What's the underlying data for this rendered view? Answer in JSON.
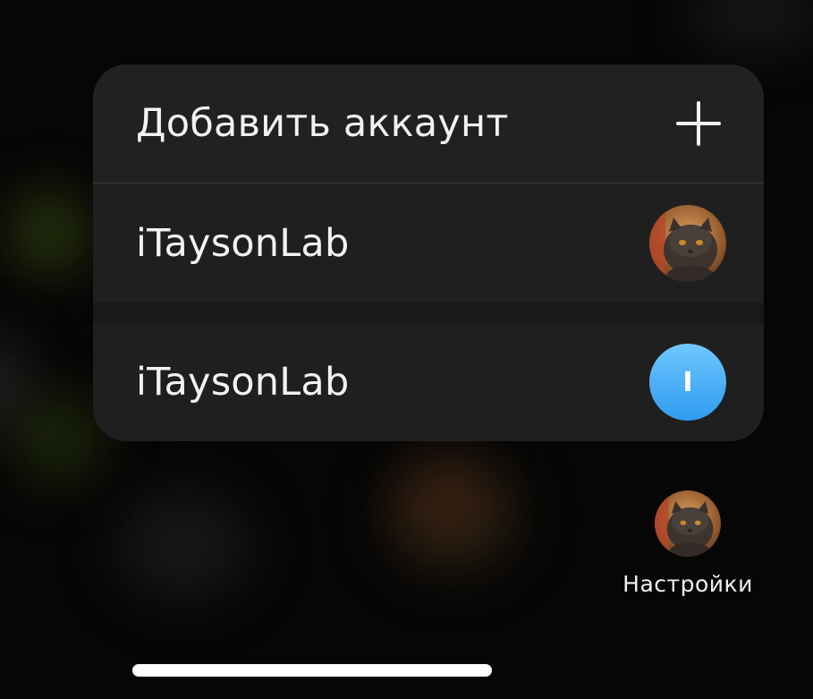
{
  "menu": {
    "add_account_label": "Добавить аккаунт",
    "add_icon": "plus-icon",
    "accounts": [
      {
        "name": "iTaysonLab",
        "avatar": "cat-photo"
      },
      {
        "name": "iTaysonLab",
        "avatar": "initial",
        "initial": "I",
        "avatar_color": "#3aa6f5"
      }
    ]
  },
  "dock": {
    "settings_label": "Настройки",
    "settings_avatar": "cat-photo"
  },
  "colors": {
    "background": "#060606",
    "menu_background": "#202020",
    "text": "#f2f2f2",
    "accent_blue": "#3aa6f5"
  }
}
